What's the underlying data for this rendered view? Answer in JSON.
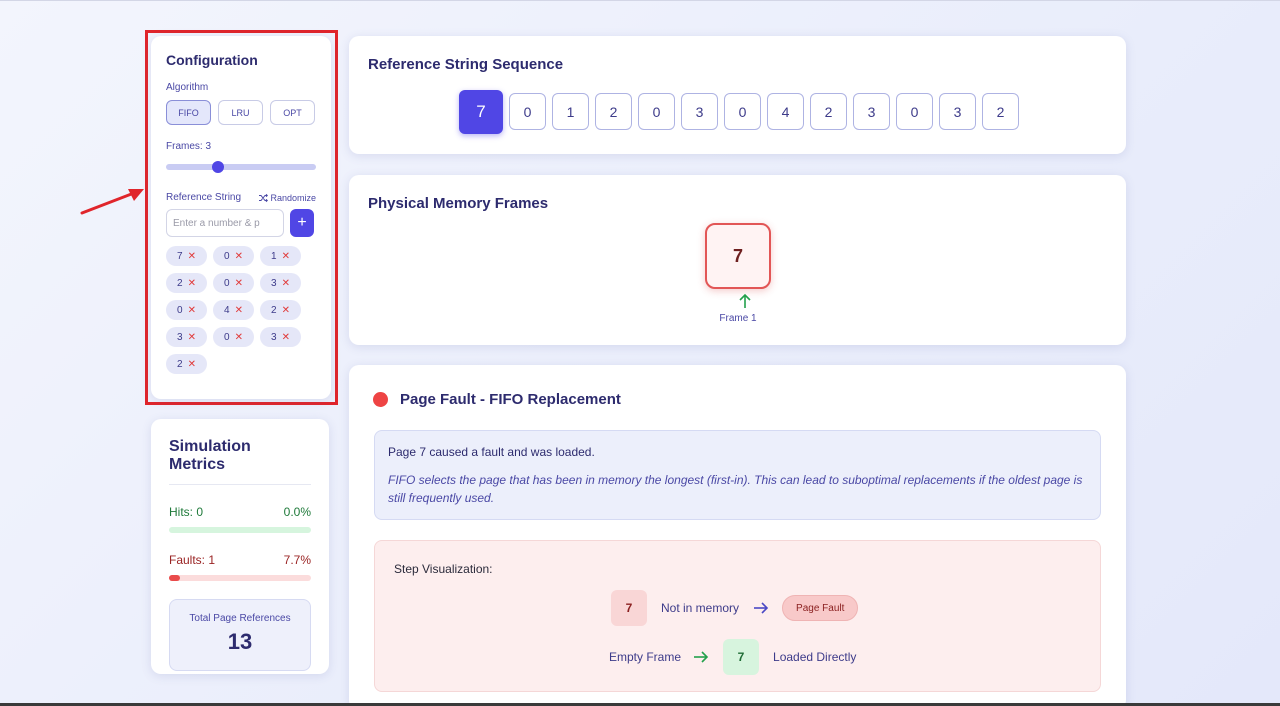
{
  "config": {
    "title": "Configuration",
    "algorithm_label": "Algorithm",
    "algorithms": [
      {
        "label": "FIFO",
        "active": true
      },
      {
        "label": "LRU",
        "active": false
      },
      {
        "label": "OPT",
        "active": false
      }
    ],
    "frames_label": "Frames: 3",
    "frames_value": 3,
    "frames_min": 1,
    "frames_max": 7,
    "reference_label": "Reference String",
    "randomize_label": "Randomize",
    "input_placeholder": "Enter a number & p",
    "add_label": "+",
    "chips": [
      "7",
      "0",
      "1",
      "2",
      "0",
      "3",
      "0",
      "4",
      "2",
      "3",
      "0",
      "3",
      "2"
    ],
    "remove_glyph": "✕"
  },
  "metrics": {
    "title": "Simulation Metrics",
    "hits_label": "Hits: 0",
    "hits_pct": "0.0%",
    "hits_fraction": 0.0,
    "faults_label": "Faults: 1",
    "faults_pct": "7.7%",
    "faults_fraction": 0.077,
    "total_label": "Total Page References",
    "total_value": "13"
  },
  "sequence": {
    "title": "Reference String Sequence",
    "values": [
      "7",
      "0",
      "1",
      "2",
      "0",
      "3",
      "0",
      "4",
      "2",
      "3",
      "0",
      "3",
      "2"
    ],
    "current_index": 0
  },
  "frames": {
    "title": "Physical Memory Frames",
    "items": [
      {
        "value": "7",
        "label": "Frame 1"
      }
    ]
  },
  "fault": {
    "title": "Page Fault - FIFO Replacement",
    "message": "Page 7 caused a fault and was loaded.",
    "description": "FIFO selects the page that has been in memory the longest (first-in). This can lead to suboptimal replacements if the oldest page is still frequently used.",
    "step_title": "Step Visualization:",
    "step1": {
      "page": "7",
      "text": "Not in memory",
      "badge": "Page Fault"
    },
    "step2": {
      "text": "Empty Frame",
      "page": "7",
      "result": "Loaded Directly"
    }
  },
  "colors": {
    "accent": "#5046e5",
    "fault": "#ee4444",
    "hit": "#1f7a3a",
    "annotation": "#e0252b"
  }
}
